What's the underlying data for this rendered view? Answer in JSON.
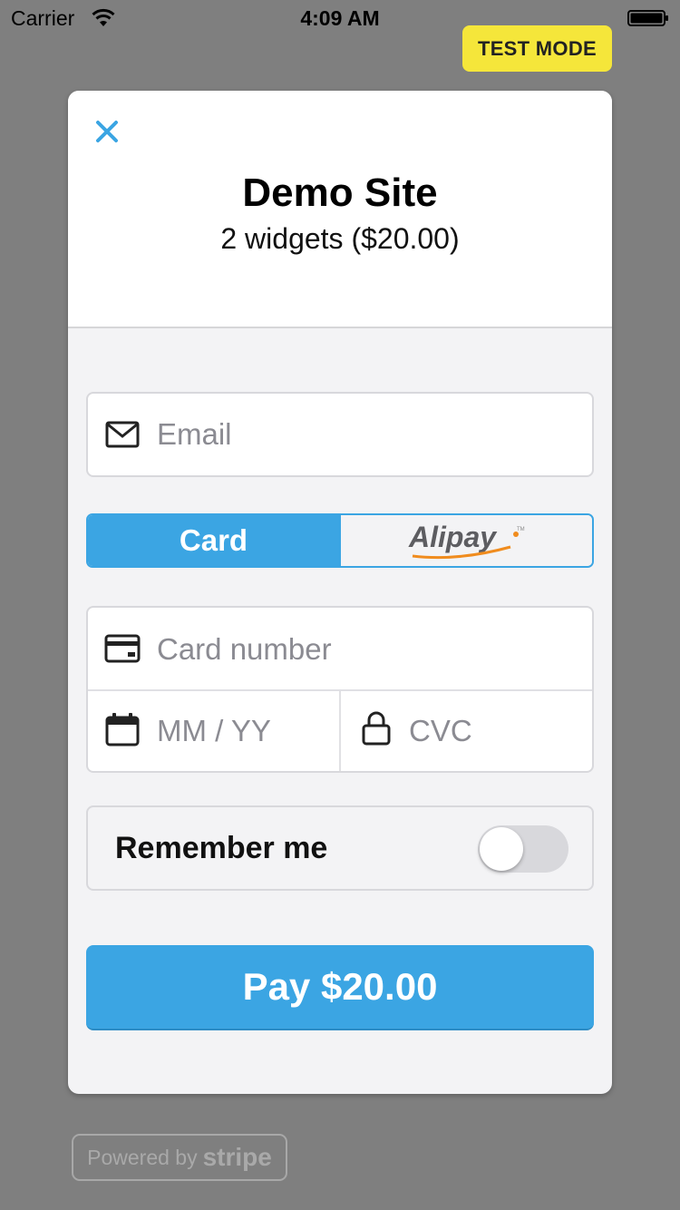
{
  "status_bar": {
    "carrier": "Carrier",
    "time": "4:09 AM"
  },
  "badge": {
    "test_mode": "TEST MODE",
    "color": "#f5e63a"
  },
  "checkout": {
    "title": "Demo Site",
    "description": "2 widgets ($20.00)",
    "close_icon": "close-icon",
    "email": {
      "placeholder": "Email",
      "value": "",
      "icon": "envelope-icon"
    },
    "payment_methods": [
      {
        "label": "Card",
        "selected": true
      },
      {
        "label": "Alipay",
        "selected": false
      }
    ],
    "card_number": {
      "placeholder": "Card number",
      "value": "",
      "icon": "credit-card-icon"
    },
    "expiry": {
      "placeholder": "MM / YY",
      "value": "",
      "icon": "calendar-icon"
    },
    "cvc": {
      "placeholder": "CVC",
      "value": "",
      "icon": "lock-icon"
    },
    "remember_me": {
      "label": "Remember me",
      "enabled": false
    },
    "pay_button": "Pay $20.00",
    "accent_color": "#3ba5e3"
  },
  "footer": {
    "powered_by": "Powered by",
    "brand": "stripe"
  }
}
